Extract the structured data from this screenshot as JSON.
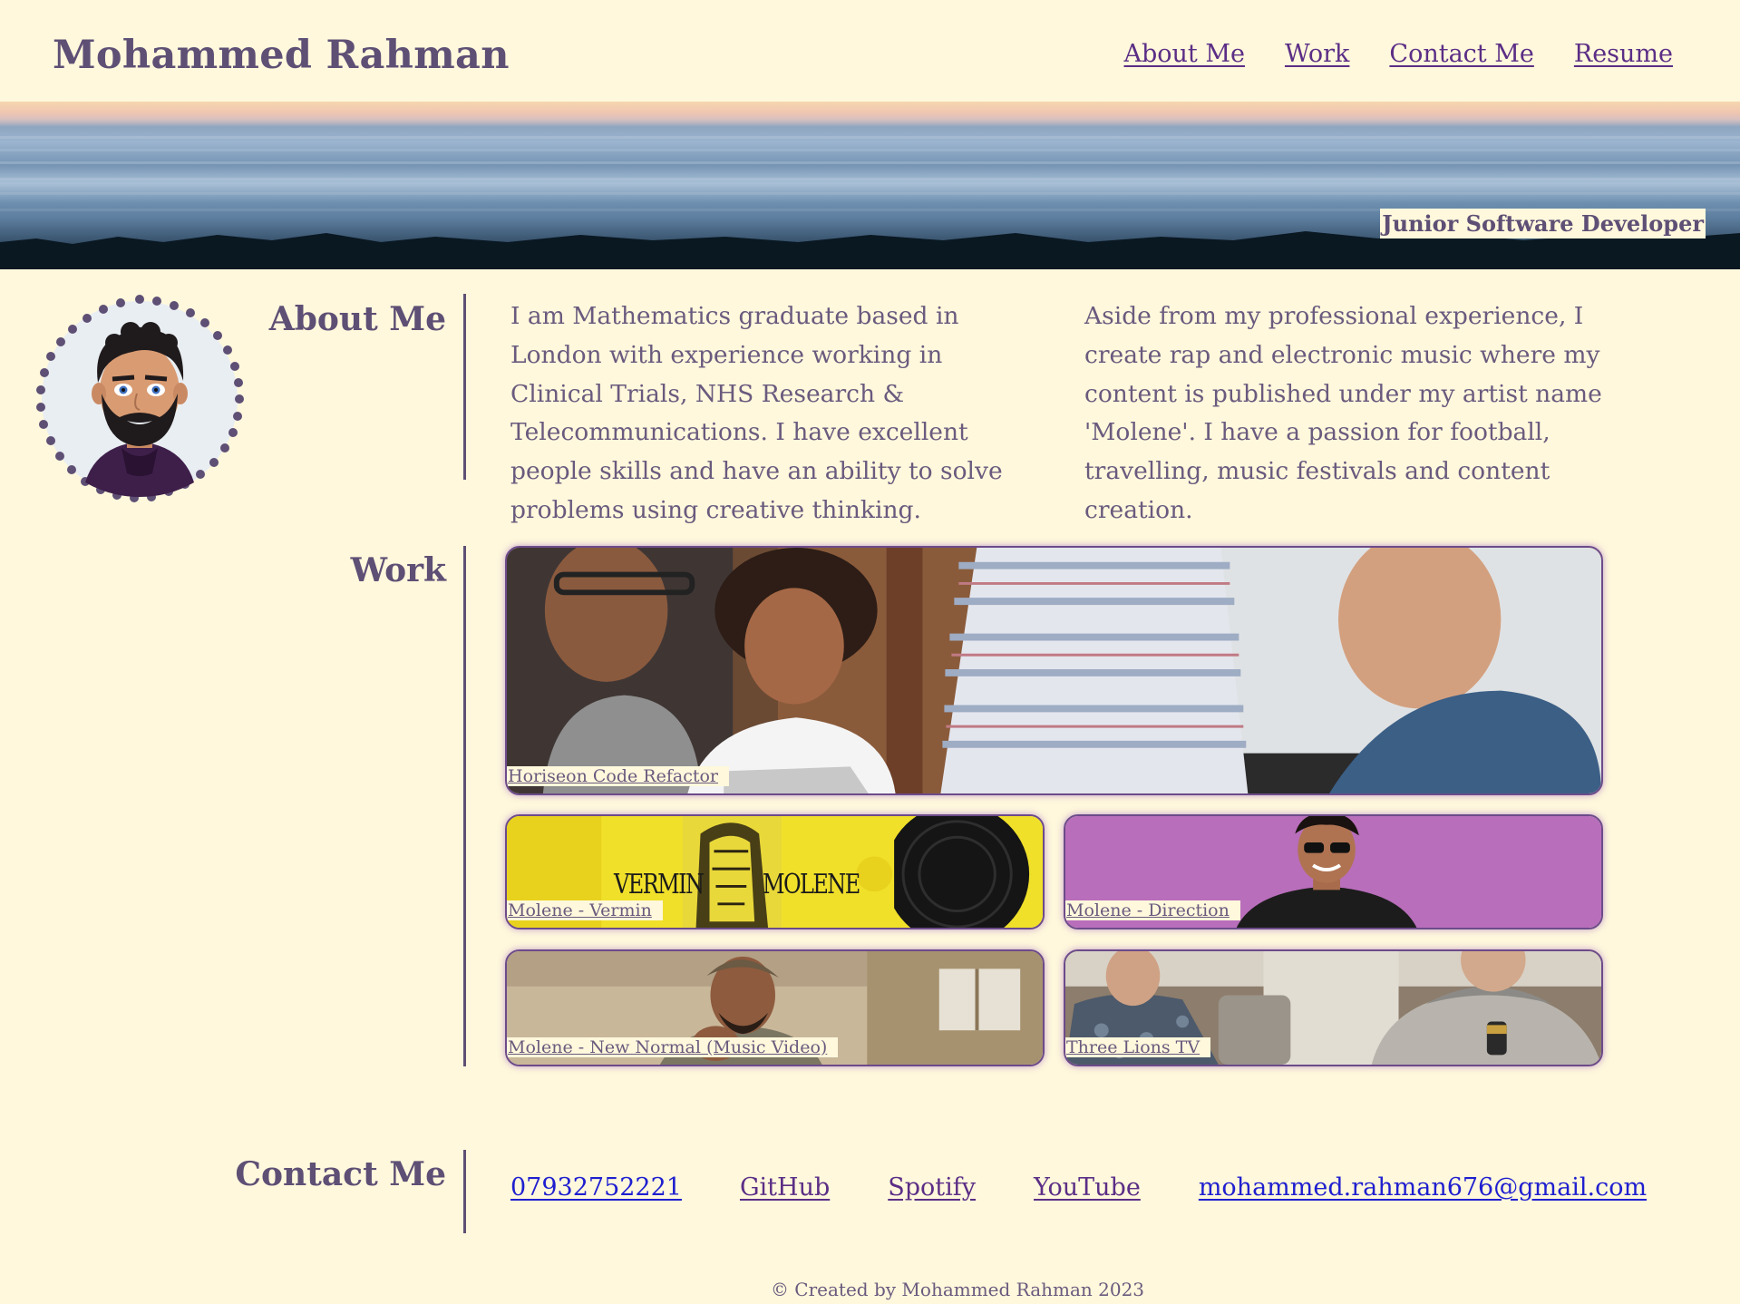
{
  "header": {
    "title": "Mohammed Rahman",
    "nav": [
      "About Me",
      "Work",
      "Contact Me",
      "Resume"
    ]
  },
  "hero": {
    "tagline": "Junior Software Developer"
  },
  "about": {
    "heading": "About Me",
    "col1": "I am Mathematics graduate based in London with experience working in Clinical Trials, NHS Research & Telecommunications. I have excellent people skills and have an ability to solve problems using creative thinking.",
    "col2": "Aside from my professional experience, I create rap and electronic music where my content is published under my artist name 'Molene'. I have a passion for football, travelling, music festivals and content creation."
  },
  "work": {
    "heading": "Work",
    "items": [
      {
        "label": "Horiseon Code Refactor"
      },
      {
        "label": "Molene - Vermin",
        "art_text_left": "VERMIN",
        "art_text_right": "MOLENE"
      },
      {
        "label": "Molene - Direction"
      },
      {
        "label": "Molene - New Normal (Music Video)"
      },
      {
        "label": "Three Lions TV"
      }
    ]
  },
  "contact": {
    "heading": "Contact Me",
    "phone": "07932752221",
    "github": "GitHub",
    "spotify": "Spotify",
    "youtube": "YouTube",
    "email": "mohammed.rahman676@gmail.com"
  },
  "footer": {
    "text": "© Created by Mohammed Rahman 2023"
  },
  "colors": {
    "background": "#fff8dc",
    "heading": "#5e4f75",
    "nav_link": "#5b2e86",
    "unvisited_link": "#1f1fd0",
    "card_border": "#6d4b8a"
  }
}
